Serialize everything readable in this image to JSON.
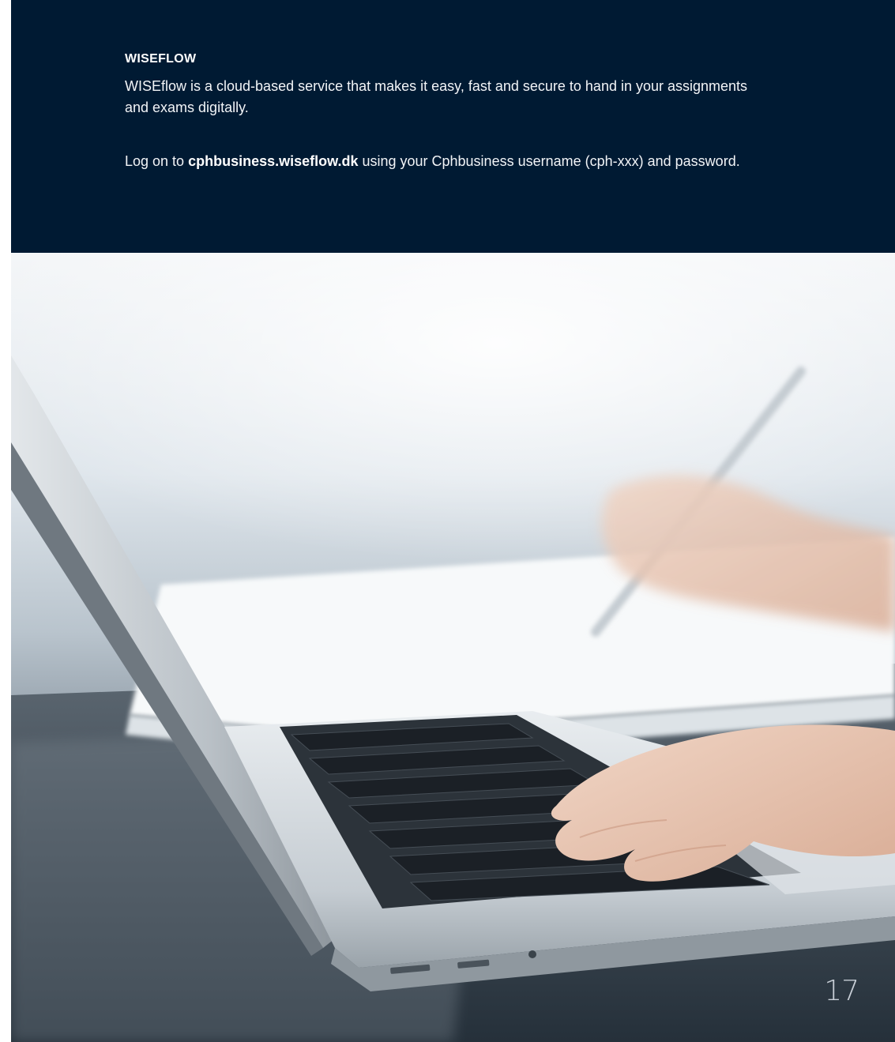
{
  "info_panel": {
    "title": "WISEFLOW",
    "paragraph_1": "WISEflow is a cloud-based service that makes it easy, fast and secure to hand in your assignments and exams digitally.",
    "paragraph_2_prefix": "Log on to ",
    "paragraph_2_link": "cphbusiness.wiseflow.dk",
    "paragraph_2_suffix": " using your Cphbusiness username (cph-xxx) and password.",
    "background_color": "#001a33"
  },
  "page_number": "17"
}
